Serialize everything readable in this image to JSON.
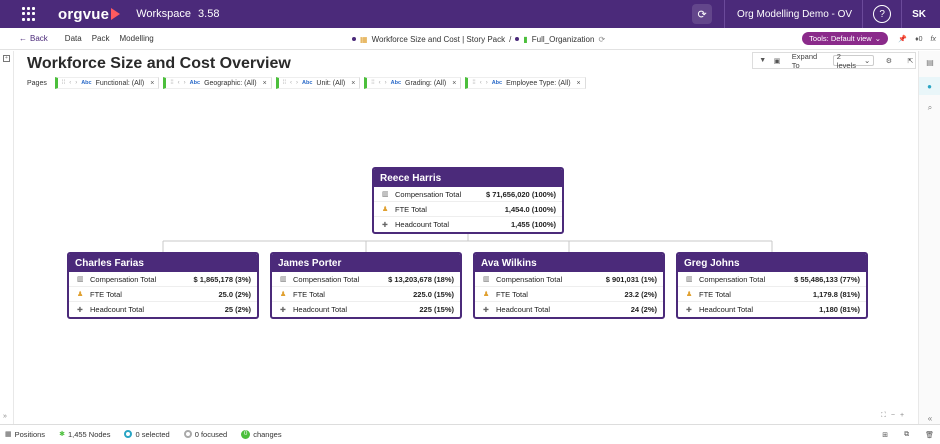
{
  "topbar": {
    "logo": "orgvue",
    "workspace_label": "Workspace",
    "workspace_version": "3.58",
    "org_name": "Org Modelling Demo - OV",
    "help": "?",
    "user_initials": "SK"
  },
  "navbar": {
    "back_label": "Back",
    "menu": [
      "Data",
      "Pack",
      "Modelling"
    ],
    "story_pack": "Workforce Size and Cost | Story Pack",
    "crumb_sep": "/",
    "dataset": "Full_Organization",
    "tools_label": "Tools: Default view",
    "count": "0",
    "fx": "fx"
  },
  "page": {
    "title": "Workforce Size and Cost Overview"
  },
  "toolbar": {
    "expand_label": "Expand To",
    "expand_value": "2 levels"
  },
  "filters": {
    "label": "Pages",
    "abc": "Abc",
    "items": [
      "Functional: (All)",
      "Geographic: (All)",
      "Unit: (All)",
      "Grading: (All)",
      "Employee Type: (All)"
    ]
  },
  "metric_labels": {
    "comp": "Compensation Total",
    "fte": "FTE Total",
    "head": "Headcount Total"
  },
  "org": {
    "root": {
      "name": "Reece Harris",
      "comp": "$ 71,656,020 (100%)",
      "fte": "1,454.0 (100%)",
      "head": "1,455 (100%)"
    },
    "children": [
      {
        "name": "Charles Farias",
        "comp": "$ 1,865,178 (3%)",
        "fte": "25.0 (2%)",
        "head": "25 (2%)"
      },
      {
        "name": "James Porter",
        "comp": "$ 13,203,678 (18%)",
        "fte": "225.0 (15%)",
        "head": "225 (15%)"
      },
      {
        "name": "Ava Wilkins",
        "comp": "$ 901,031 (1%)",
        "fte": "23.2 (2%)",
        "head": "24 (2%)"
      },
      {
        "name": "Greg Johns",
        "comp": "$ 55,486,133 (77%)",
        "fte": "1,179.8 (81%)",
        "head": "1,180 (81%)"
      }
    ]
  },
  "statusbar": {
    "positions": "Positions",
    "nodes": "1,455 Nodes",
    "selected": "0 selected",
    "focused": "0 focused",
    "changes_count": "0",
    "changes": "changes"
  },
  "colors": {
    "brand": "#4b2a7a",
    "accent": "#8a2a8a",
    "filter_chip": "#4cbf3c",
    "teal": "#2aa5c4"
  }
}
